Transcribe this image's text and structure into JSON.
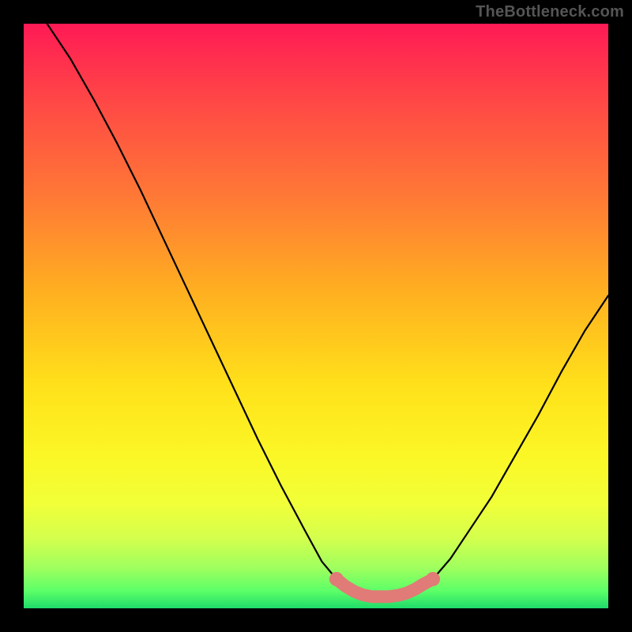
{
  "branding": "TheBottleneck.com",
  "chart_data": {
    "type": "line",
    "title": "",
    "xlabel": "",
    "ylabel": "",
    "xlim": [
      0,
      100
    ],
    "ylim": [
      0,
      100
    ],
    "annotations": [],
    "background_gradient": {
      "colors_top_to_bottom": [
        "#ff1a55",
        "#ff5a3c",
        "#ff9a2a",
        "#ffd21f",
        "#fff029",
        "#f4ff3a",
        "#c6ff55",
        "#7cff67",
        "#22e06b"
      ]
    },
    "series": [
      {
        "name": "left-descending-curve",
        "color": "#000000",
        "x": [
          4,
          8,
          12,
          16,
          20,
          24,
          28,
          32,
          36,
          40,
          44,
          48,
          51,
          53.5
        ],
        "y": [
          100,
          94,
          87,
          79.5,
          71.5,
          63,
          54.5,
          46,
          37.5,
          29,
          21,
          13.5,
          8,
          5
        ]
      },
      {
        "name": "right-ascending-curve",
        "color": "#000000",
        "x": [
          70,
          73,
          76,
          80,
          84,
          88,
          92,
          96,
          100
        ],
        "y": [
          5,
          8.5,
          13,
          19,
          26,
          33,
          40.5,
          47.5,
          53.5
        ]
      },
      {
        "name": "valley-marker",
        "color": "#e07b77",
        "style": "thick",
        "x": [
          53.5,
          55,
          56.5,
          58,
          59.5,
          61,
          62.5,
          64,
          65.5,
          67,
          68.5,
          70
        ],
        "y": [
          5.0,
          3.8,
          2.9,
          2.3,
          2.0,
          2.0,
          2.0,
          2.2,
          2.6,
          3.3,
          4.2,
          5.0
        ]
      },
      {
        "name": "valley-endpoint-left",
        "color": "#e07b77",
        "style": "point",
        "x": [
          53.5
        ],
        "y": [
          5.0
        ]
      },
      {
        "name": "valley-endpoint-right",
        "color": "#e07b77",
        "style": "point",
        "x": [
          70
        ],
        "y": [
          5.0
        ]
      }
    ]
  }
}
